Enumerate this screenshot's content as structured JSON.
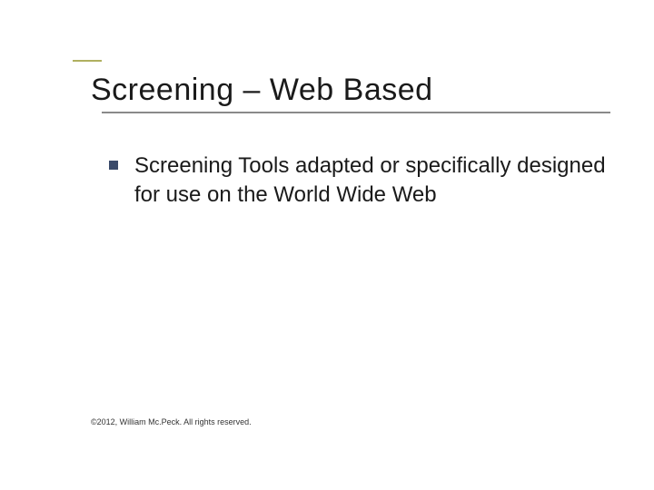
{
  "slide": {
    "title": "Screening – Web Based",
    "bullets": [
      {
        "text": "Screening Tools adapted or specifically designed for use on the World Wide Web"
      }
    ],
    "footer": "©2012, William Mc.Peck. All rights reserved."
  }
}
